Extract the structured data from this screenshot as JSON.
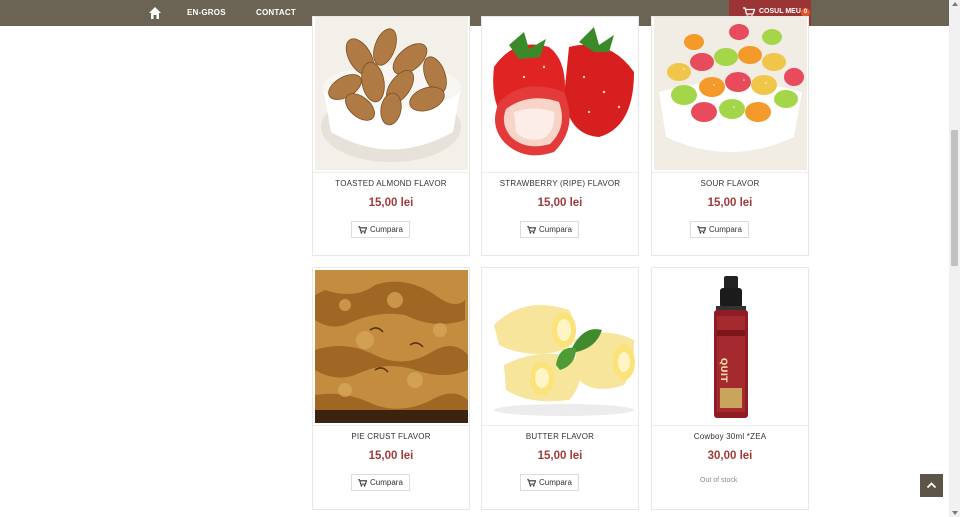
{
  "nav": {
    "links": [
      "EN-GROS",
      "CONTACT"
    ],
    "cart_label": "COSUL MEU",
    "cart_count": "0"
  },
  "products": [
    {
      "name": "TOASTED ALMOND FLAVOR",
      "price": "15,00 lei",
      "action": "Cumpara",
      "image_icon": "almonds-image"
    },
    {
      "name": "STRAWBERRY (RIPE) FLAVOR",
      "price": "15,00 lei",
      "action": "Cumpara",
      "image_icon": "strawberry-image"
    },
    {
      "name": "SOUR FLAVOR",
      "price": "15,00 lei",
      "action": "Cumpara",
      "image_icon": "sour-candy-image"
    },
    {
      "name": "PIE CRUST FLAVOR",
      "price": "15,00 lei",
      "action": "Cumpara",
      "image_icon": "pie-crust-image"
    },
    {
      "name": "BUTTER FLAVOR",
      "price": "15,00 lei",
      "action": "Cumpara",
      "image_icon": "butter-image"
    },
    {
      "name": "Cowboy 30ml *ZEA",
      "price": "30,00 lei",
      "status": "Out of stock",
      "image_icon": "eliquid-bottle-image",
      "bottle_text": "QUIT"
    }
  ],
  "colors": {
    "topbar": "#6b6454",
    "cart": "#9b3434",
    "price": "#a13b3b"
  }
}
